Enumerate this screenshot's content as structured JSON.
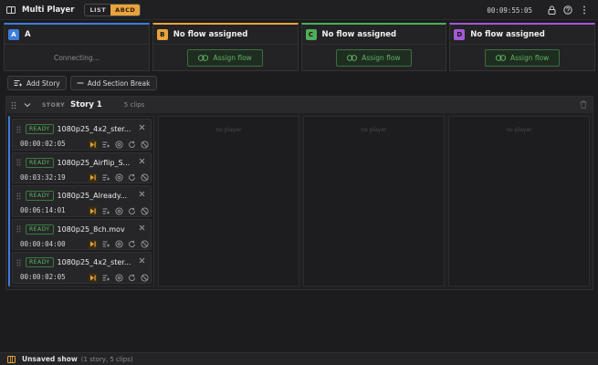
{
  "app": {
    "title": "Multi Player",
    "view_list": "LIST",
    "view_abcd": "ABCD",
    "clock": "00:09:55:05"
  },
  "colors": {
    "accent": "#e8a33c",
    "channel_a": "#3d7dd9",
    "channel_b": "#e8a33c",
    "channel_c": "#4fae59",
    "channel_d": "#a35ad6",
    "ready": "#5dbb62"
  },
  "channels": [
    {
      "letter": "A",
      "name": "A",
      "status": "Connecting..."
    },
    {
      "letter": "B",
      "name": "No flow assigned",
      "action": "Assign flow"
    },
    {
      "letter": "C",
      "name": "No flow assigned",
      "action": "Assign flow"
    },
    {
      "letter": "D",
      "name": "No flow assigned",
      "action": "Assign flow"
    }
  ],
  "actions": {
    "add_story": "Add Story",
    "add_section_break": "Add Section Break"
  },
  "story": {
    "tag": "STORY",
    "name": "Story 1",
    "count": "5 clips",
    "no_player": "no player",
    "clips": [
      {
        "status": "READY",
        "name": "1080p25_4x2_ster...",
        "duration": "00:00:02:05"
      },
      {
        "status": "READY",
        "name": "1080p25_Airflip_S...",
        "duration": "00:03:32:19"
      },
      {
        "status": "READY",
        "name": "1080p25_Already...",
        "duration": "00:06:14:01"
      },
      {
        "status": "READY",
        "name": "1080p25_8ch.mov",
        "duration": "00:00:04:00"
      },
      {
        "status": "READY",
        "name": "1080p25_4x2_ster...",
        "duration": "00:00:02:05"
      }
    ]
  },
  "status_bar": {
    "main": "Unsaved show",
    "detail": "(1 story, 5 clips)"
  },
  "icons": {
    "app": "multiplayer-icon",
    "lock": "lock-icon",
    "help": "help-icon",
    "menu": "kebab-menu-icon",
    "link": "link-icon",
    "drag": "drag-handle-icon",
    "chevron": "chevron-down-icon",
    "close": "close-icon",
    "trash": "trash-icon"
  }
}
